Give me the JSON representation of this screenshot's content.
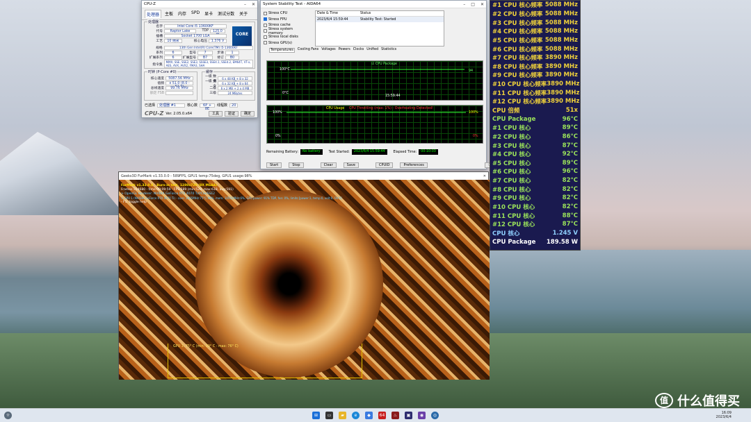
{
  "cpuz": {
    "title": "CPU-Z",
    "tabs": [
      "处理器",
      "主板",
      "内存",
      "SPD",
      "显卡",
      "测试分数",
      "关于"
    ],
    "group_proc": "处理器",
    "name_l": "名字",
    "name": "Intel Core i5 13600KF",
    "code_l": "代号",
    "code": "Raptor Lake",
    "tdp_l": "TDP",
    "tdp": "125.0 W",
    "sock_l": "插槽",
    "sock": "Socket 1700 LGA",
    "tech_l": "工艺",
    "tech": "10 纳米",
    "volt_l": "核心电压",
    "volt": "1.376 V",
    "spec_l": "规格",
    "spec": "13th Gen Intel(R) Core(TM) i5-13600KF",
    "fam_l": "系列",
    "fam": "6",
    "mod_l": "型号",
    "mod": "7",
    "step_l": "步进",
    "step": "1",
    "efam_l": "扩展系列",
    "efam": "6",
    "emod_l": "扩展型号",
    "emod": "B7",
    "rev_l": "修订",
    "rev": "B0",
    "inst_l": "指令集",
    "inst": "MMX, SSE, SSE2, SSE3, SSSE3, SSE4.1, SSE4.2, EM64T, VT-x, AES, AVX, AVX2, FMA3, SHA",
    "clk_group": "时钟 (P-Core #0)",
    "cache_group": "缓存",
    "core_spd_l": "核心速度",
    "core_spd": "5087.56 MHz",
    "mult_l": "倍频",
    "mult": "x 51.0 (8.0 - 51.0)",
    "bus_l": "总线速度",
    "bus": "99.76 MHz",
    "fsb_l": "额定 FSB",
    "fsb": "",
    "l1d_l": "一级 数据",
    "l1d": "6 x 48 KB + 8 x 32 KB",
    "l1i_l": "一级 指令",
    "l1i": "6 x 32 KB + 8 x 64 KB",
    "l2_l": "二级",
    "l2": "6 x 2 MB + 2 x 4 MB",
    "l3_l": "三级",
    "l3": "24 MBytes",
    "sel_l": "已选择",
    "sel": "处理器 #1",
    "cores_l": "核心数",
    "cores": "6P + 8E",
    "thr_l": "线程数",
    "thr": "20",
    "ver": "Ver. 2.05.0.x64",
    "brand": "CPU-Z",
    "tool": "工具",
    "verify": "验证",
    "ok": "确定",
    "logo": "CORE"
  },
  "aida": {
    "title": "System Stability Test - AIDA64",
    "checks": [
      {
        "label": "Stress CPU",
        "on": false
      },
      {
        "label": "Stress FPU",
        "on": true
      },
      {
        "label": "Stress cache",
        "on": false
      },
      {
        "label": "Stress system memory",
        "on": false
      },
      {
        "label": "Stress local disks",
        "on": false
      },
      {
        "label": "Stress GPU(s)",
        "on": false
      }
    ],
    "col_date": "Date & Time",
    "col_status": "Status",
    "row_date": "2023/6/4 15:59:44",
    "row_status": "Stability Test: Started",
    "tabs": [
      "Temperatures",
      "Cooling Fans",
      "Voltages",
      "Powers",
      "Clocks",
      "Unified",
      "Statistics"
    ],
    "g1_legend": "CPU Package",
    "g1_top": "100°C",
    "g1_bot": "0°C",
    "g1_val": "94",
    "g1_time": "15:59:44",
    "g2_title": "CPU Usage",
    "g2_throttle": "CPU Throttling (max: 1%) - Overheating Detected!",
    "g2_top": "100%",
    "g2_bot": "0%",
    "g2_rtop": "100%",
    "g2_rbot": "0%",
    "batt_l": "Remaining Battery:",
    "batt": "No battery",
    "start_l": "Test Started:",
    "start": "2023/6/4 15:59:44",
    "el_l": "Elapsed Time:",
    "el": "00:10:03",
    "btns": [
      "Start",
      "Stop",
      "Clear",
      "Save",
      "CPUID",
      "Preferences",
      "Close"
    ]
  },
  "furmark": {
    "title": "Geeks3D FurMark v1.33.0.0 - 589FPS, GPU1 temp:75deg, GPU1 usage:98%",
    "l1": "FurMark v1.33.0.0 - Burn-in test, 1280x720 (8X MSAA)",
    "l2": "Frames:354680 - time:00:09:59 - FPS:589 (min:528, max:618, avg:591)",
    "l3": "> OpenGL renderer: NVIDIA GeForce RTX 4070 Ti/PCIe/SSE2",
    "l4": "> GPU 1 (NVIDIA GeForce RTX 4070 Ti) - core: 2805MHz:75°C:98%, mem: 10501MHz:6%, GPU power: 91% TDP, fan: 0%, limits:[power:1, temp:0, volt:0, OV:0]",
    "l5": "- F1: toggle help",
    "temp": "GPU 1: 75° C (min: 39° C - max: 76° C)"
  },
  "overlay": {
    "rows": [
      {
        "k": "#1 CPU 核心频率",
        "v": "5088 MHz",
        "c": "#f0d23a"
      },
      {
        "k": "#2 CPU 核心频率",
        "v": "5088 MHz",
        "c": "#f0d23a"
      },
      {
        "k": "#3 CPU 核心频率",
        "v": "5088 MHz",
        "c": "#f0d23a"
      },
      {
        "k": "#4 CPU 核心频率",
        "v": "5088 MHz",
        "c": "#f0d23a"
      },
      {
        "k": "#5 CPU 核心频率",
        "v": "5088 MHz",
        "c": "#f0d23a"
      },
      {
        "k": "#6 CPU 核心频率",
        "v": "5088 MHz",
        "c": "#f0d23a"
      },
      {
        "k": "#7 CPU 核心频率",
        "v": "3890 MHz",
        "c": "#f0d23a"
      },
      {
        "k": "#8 CPU 核心频率",
        "v": "3890 MHz",
        "c": "#f0d23a"
      },
      {
        "k": "#9 CPU 核心频率",
        "v": "3890 MHz",
        "c": "#f0d23a"
      },
      {
        "k": "#10 CPU 核心频率",
        "v": "3890 MHz",
        "c": "#f0d23a"
      },
      {
        "k": "#11 CPU 核心频率",
        "v": "3890 MHz",
        "c": "#f0d23a"
      },
      {
        "k": "#12 CPU 核心频率",
        "v": "3890 MHz",
        "c": "#f0d23a"
      },
      {
        "k": "CPU 倍频",
        "v": "51x",
        "c": "#f0d23a"
      },
      {
        "k": "CPU Package",
        "v": "96°C",
        "c": "#9be35a"
      },
      {
        "k": " #1 CPU 核心",
        "v": "89°C",
        "c": "#9be35a"
      },
      {
        "k": " #2 CPU 核心",
        "v": "86°C",
        "c": "#9be35a"
      },
      {
        "k": " #3 CPU 核心",
        "v": "87°C",
        "c": "#9be35a"
      },
      {
        "k": " #4 CPU 核心",
        "v": "92°C",
        "c": "#9be35a"
      },
      {
        "k": " #5 CPU 核心",
        "v": "89°C",
        "c": "#9be35a"
      },
      {
        "k": " #6 CPU 核心",
        "v": "96°C",
        "c": "#9be35a"
      },
      {
        "k": " #7 CPU 核心",
        "v": "82°C",
        "c": "#9be35a"
      },
      {
        "k": " #8 CPU 核心",
        "v": "82°C",
        "c": "#9be35a"
      },
      {
        "k": " #9 CPU 核心",
        "v": "82°C",
        "c": "#9be35a"
      },
      {
        "k": " #10 CPU 核心",
        "v": "82°C",
        "c": "#9be35a"
      },
      {
        "k": " #11 CPU 核心",
        "v": "88°C",
        "c": "#9be35a"
      },
      {
        "k": " #12 CPU 核心",
        "v": "87°C",
        "c": "#9be35a"
      },
      {
        "k": "CPU 核心",
        "v": "1.245 V",
        "c": "#8fd0ff"
      },
      {
        "k": "CPU Package",
        "v": "189.58 W",
        "c": "#ffffff"
      }
    ]
  },
  "taskbar": {
    "time": "16:09",
    "date": "2023/6/4"
  },
  "watermark": {
    "logo": "值",
    "text": "什么值得买"
  }
}
